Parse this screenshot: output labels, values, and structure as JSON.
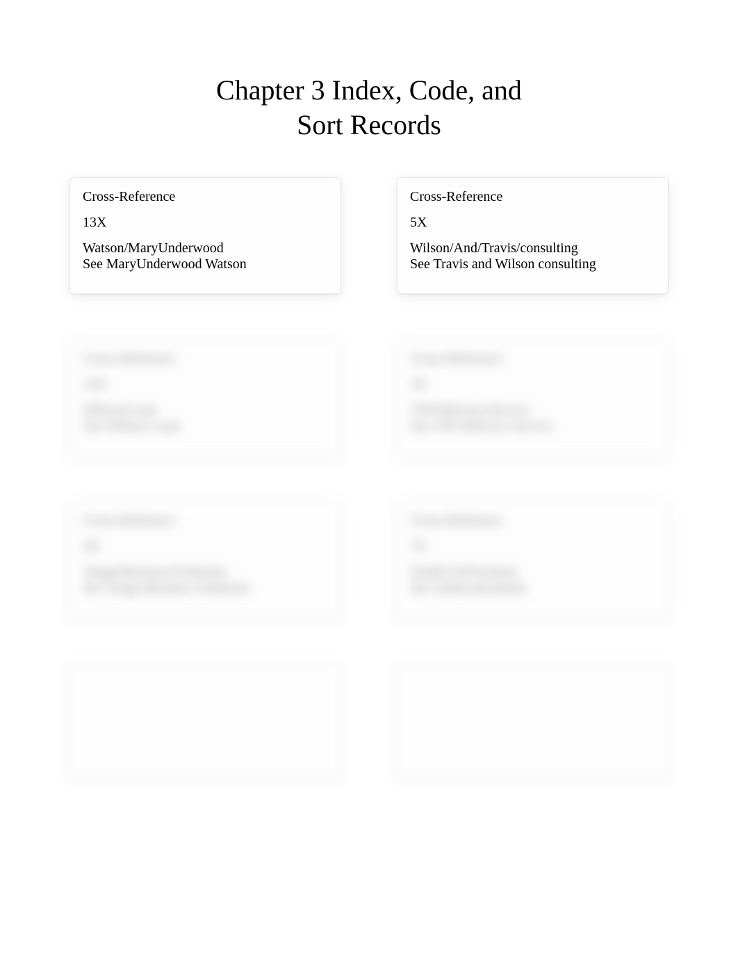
{
  "title_line1": "Chapter 3 Index, Code, and",
  "title_line2": "Sort Records",
  "cards": [
    {
      "header": "Cross-Reference",
      "code": "13X",
      "line1": "Watson/MaryUnderwood",
      "line2": "See MaryUnderwood Watson",
      "blurred": false
    },
    {
      "header": "Cross-Reference",
      "code": "5X",
      "line1": "Wilson/And/Travis/consulting",
      "line2": "See Travis and Wilson consulting",
      "blurred": false
    },
    {
      "header": "Cross-Reference",
      "code": "14X",
      "line1": "Wilson/Louis",
      "line2": "See Wilson Louis",
      "blurred": true
    },
    {
      "header": "Cross-Reference",
      "code": "2X",
      "line1": "VIP/Delivery/Service",
      "line2": "See VIP Delivery Service",
      "blurred": true
    },
    {
      "header": "Cross-Reference",
      "code": "4X",
      "line1": "Vanga/Business/Solutions",
      "line2": "See Vanga Business Solutions",
      "blurred": true
    },
    {
      "header": "Cross-Reference",
      "code": "7X",
      "line1": "Smith/A/Petroleum",
      "line2": "See Smith petroleum",
      "blurred": true
    },
    {
      "header": "",
      "code": "",
      "line1": "",
      "line2": "",
      "blurred": true,
      "empty": true
    },
    {
      "header": "",
      "code": "",
      "line1": "",
      "line2": "",
      "blurred": true,
      "empty": true
    }
  ]
}
